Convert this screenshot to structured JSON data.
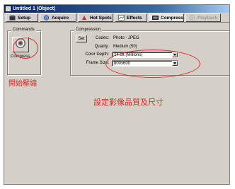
{
  "window": {
    "title": "Untitled 1 (Object)"
  },
  "tabs": [
    {
      "label": "Setup",
      "icon": "setup-icon",
      "state": "normal"
    },
    {
      "label": "Acquire",
      "icon": "acquire-icon",
      "state": "normal"
    },
    {
      "label": "Hot Spots",
      "icon": "hot-spots-icon",
      "state": "normal"
    },
    {
      "label": "Effects",
      "icon": "effects-icon",
      "state": "normal"
    },
    {
      "label": "Compress",
      "icon": "compress-icon",
      "state": "active"
    },
    {
      "label": "Playback",
      "icon": "playback-icon",
      "state": "disabled"
    }
  ],
  "commands": {
    "group_label": "Commands",
    "compress_label": "Compress"
  },
  "compression": {
    "group_label": "Compression",
    "set_label": "Set",
    "codec_label": "Codec:",
    "codec_value": "Photo - JPEG",
    "quality_label": "Quality:",
    "quality_value": "Medium (50)",
    "color_depth_label": "Color Depth:",
    "color_depth_value": "24 bit (Millions)",
    "frame_size_label": "Frame Size:",
    "frame_size_value": "800x600"
  },
  "annotations": {
    "start_compress": "開始壓縮",
    "set_quality_size": "設定影像品質及尺寸",
    "color": "#e02020"
  }
}
